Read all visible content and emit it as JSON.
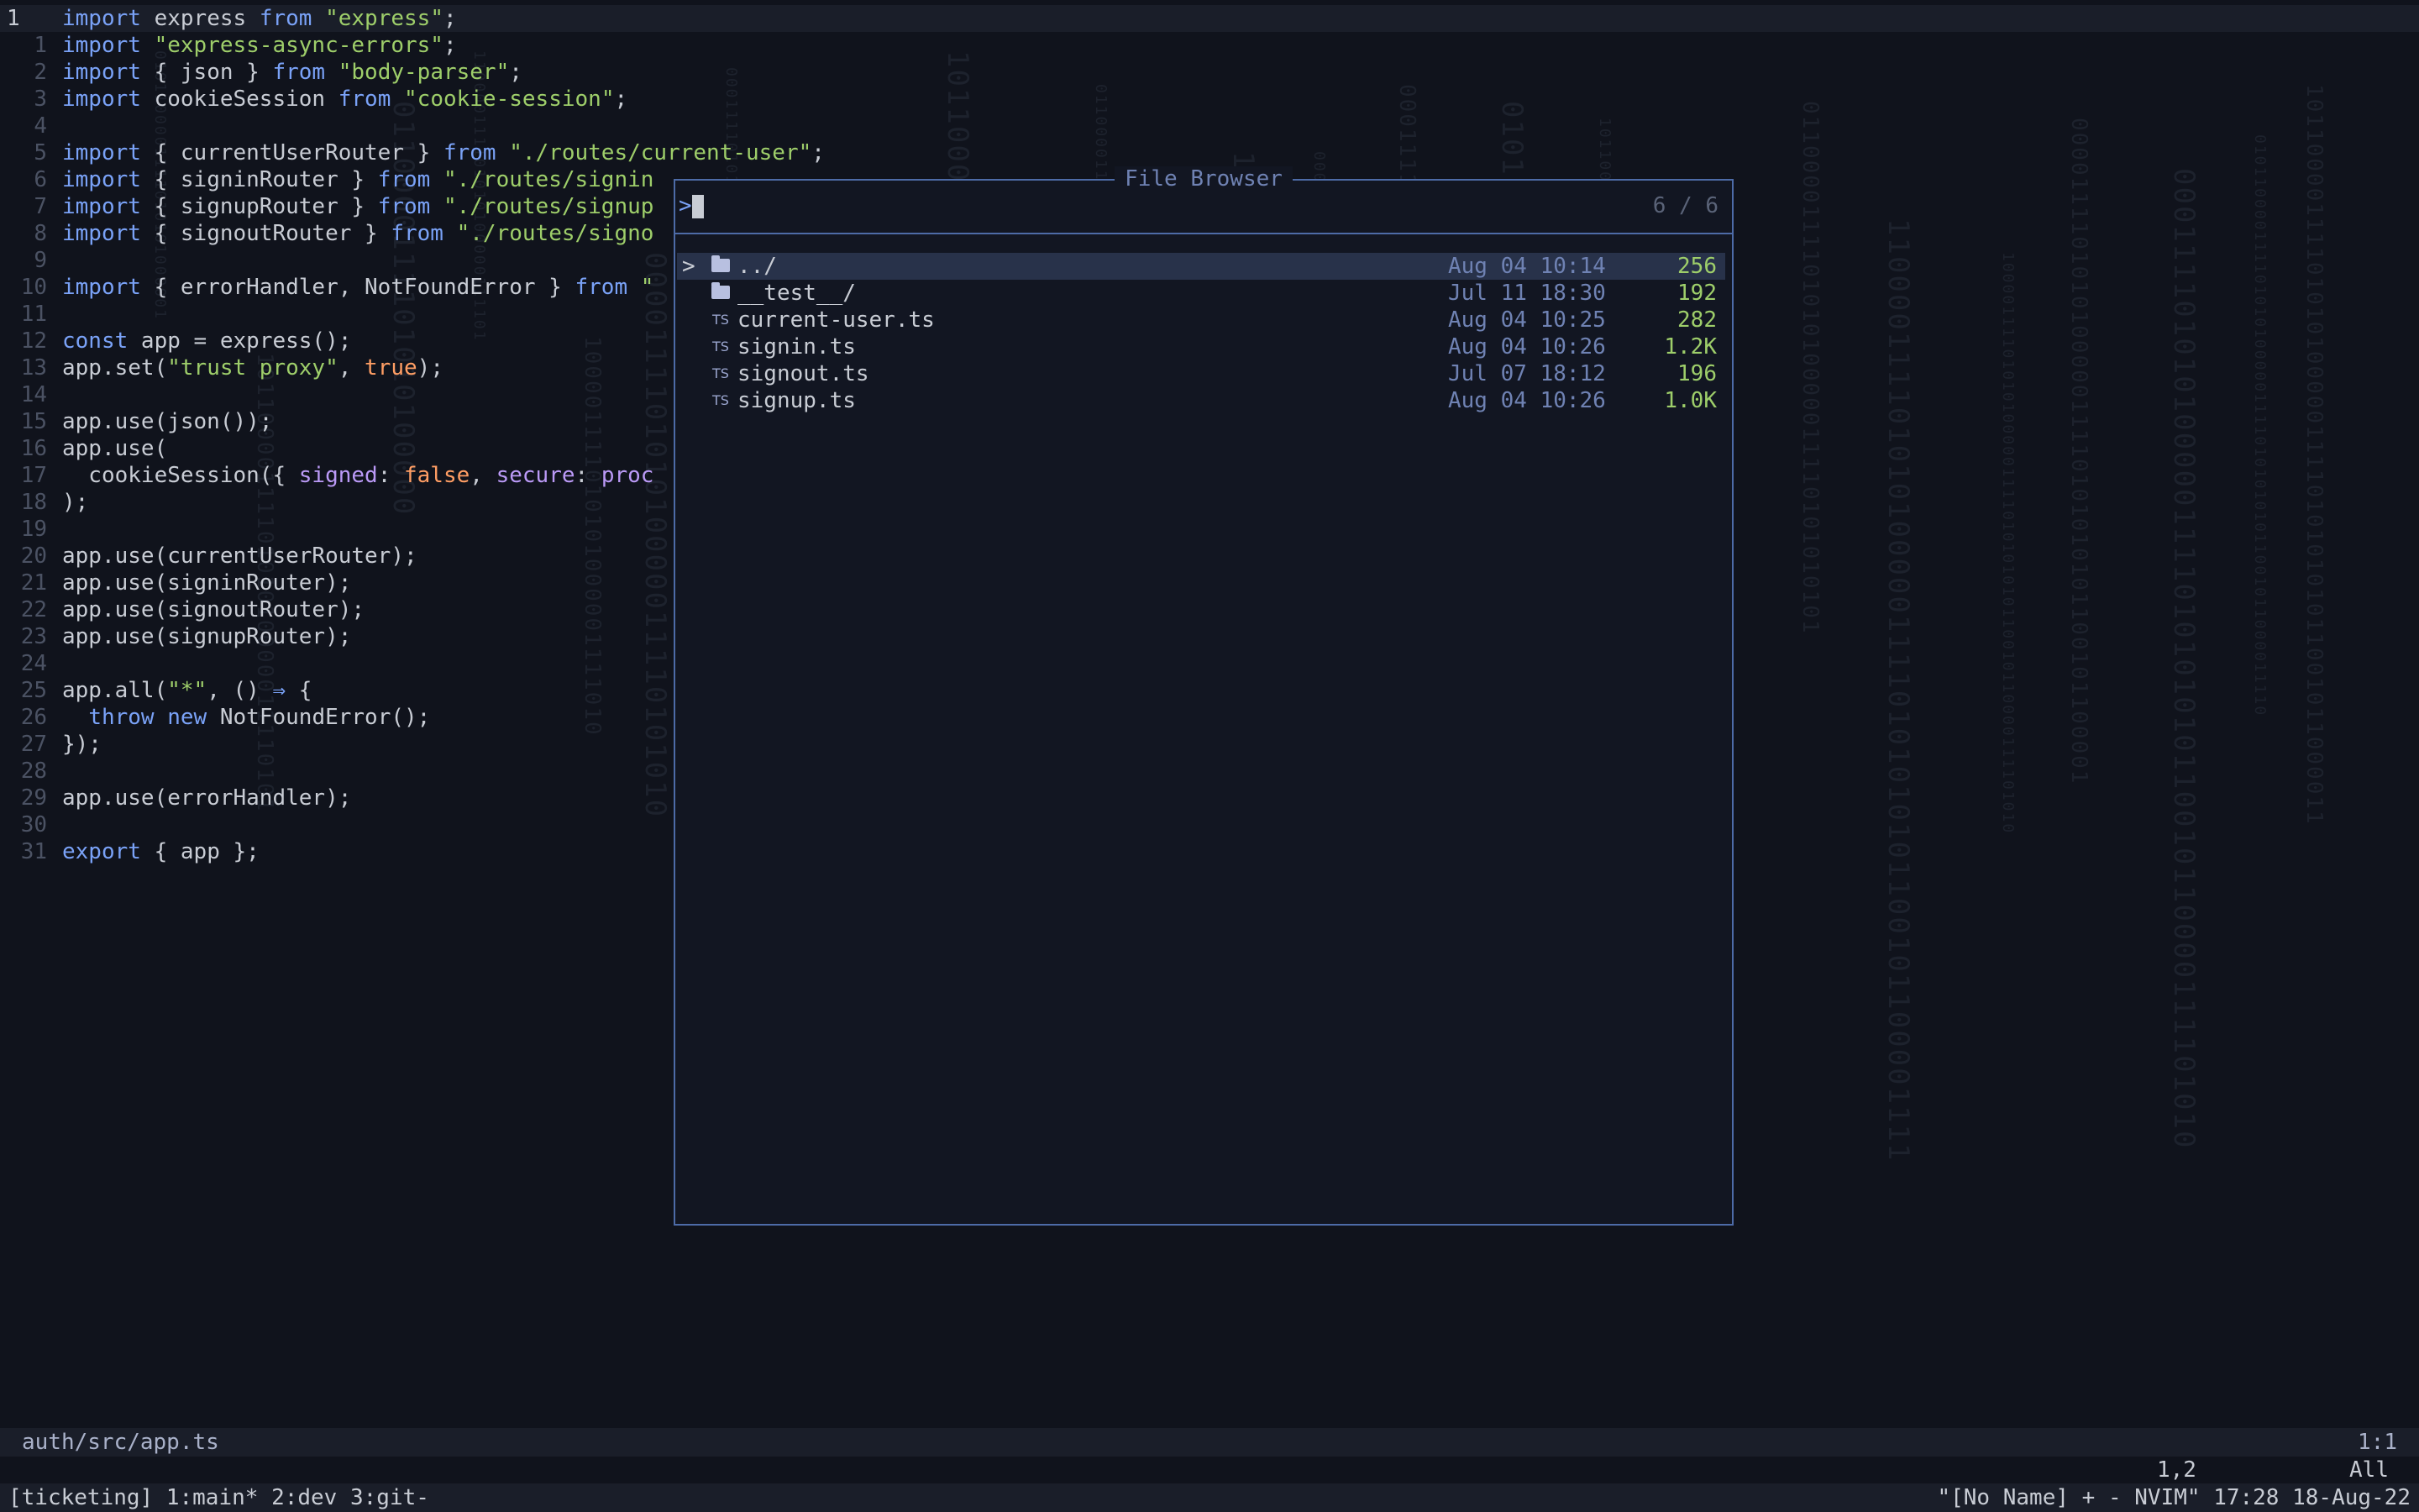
{
  "editor": {
    "lines": [
      {
        "n": "1",
        "t": [
          [
            "kw",
            "import"
          ],
          [
            "plain",
            " express "
          ],
          [
            "kw",
            "from"
          ],
          [
            "plain",
            " "
          ],
          [
            "str",
            "\"express\""
          ],
          [
            "plain",
            ";"
          ]
        ]
      },
      {
        "n": "1",
        "t": [
          [
            "kw",
            "import"
          ],
          [
            "plain",
            " "
          ],
          [
            "str",
            "\"express-async-errors\""
          ],
          [
            "plain",
            ";"
          ]
        ]
      },
      {
        "n": "2",
        "t": [
          [
            "kw",
            "import"
          ],
          [
            "plain",
            " { json } "
          ],
          [
            "kw",
            "from"
          ],
          [
            "plain",
            " "
          ],
          [
            "str",
            "\"body-parser\""
          ],
          [
            "plain",
            ";"
          ]
        ]
      },
      {
        "n": "3",
        "t": [
          [
            "kw",
            "import"
          ],
          [
            "plain",
            " cookieSession "
          ],
          [
            "kw",
            "from"
          ],
          [
            "plain",
            " "
          ],
          [
            "str",
            "\"cookie-session\""
          ],
          [
            "plain",
            ";"
          ]
        ]
      },
      {
        "n": "4",
        "t": []
      },
      {
        "n": "5",
        "t": [
          [
            "kw",
            "import"
          ],
          [
            "plain",
            " { currentUserRouter } "
          ],
          [
            "kw",
            "from"
          ],
          [
            "plain",
            " "
          ],
          [
            "str",
            "\"./routes/current-user\""
          ],
          [
            "plain",
            ";"
          ]
        ]
      },
      {
        "n": "6",
        "t": [
          [
            "kw",
            "import"
          ],
          [
            "plain",
            " { signinRouter } "
          ],
          [
            "kw",
            "from"
          ],
          [
            "plain",
            " "
          ],
          [
            "str",
            "\"./routes/signin"
          ]
        ]
      },
      {
        "n": "7",
        "t": [
          [
            "kw",
            "import"
          ],
          [
            "plain",
            " { signupRouter } "
          ],
          [
            "kw",
            "from"
          ],
          [
            "plain",
            " "
          ],
          [
            "str",
            "\"./routes/signup"
          ]
        ]
      },
      {
        "n": "8",
        "t": [
          [
            "kw",
            "import"
          ],
          [
            "plain",
            " { signoutRouter } "
          ],
          [
            "kw",
            "from"
          ],
          [
            "plain",
            " "
          ],
          [
            "str",
            "\"./routes/signo"
          ]
        ]
      },
      {
        "n": "9",
        "t": []
      },
      {
        "n": "10",
        "t": [
          [
            "kw",
            "import"
          ],
          [
            "plain",
            " { errorHandler, NotFoundError } "
          ],
          [
            "kw",
            "from"
          ],
          [
            "plain",
            " "
          ],
          [
            "str",
            "\""
          ]
        ]
      },
      {
        "n": "11",
        "t": []
      },
      {
        "n": "12",
        "t": [
          [
            "kw",
            "const"
          ],
          [
            "plain",
            " app = express();"
          ]
        ]
      },
      {
        "n": "13",
        "t": [
          [
            "plain",
            "app.set("
          ],
          [
            "str",
            "\"trust proxy\""
          ],
          [
            "plain",
            ", "
          ],
          [
            "bool",
            "true"
          ],
          [
            "plain",
            ");"
          ]
        ]
      },
      {
        "n": "14",
        "t": []
      },
      {
        "n": "15",
        "t": [
          [
            "plain",
            "app.use(json());"
          ]
        ]
      },
      {
        "n": "16",
        "t": [
          [
            "plain",
            "app.use("
          ]
        ]
      },
      {
        "n": "17",
        "t": [
          [
            "plain",
            "  cookieSession({ "
          ],
          [
            "prop",
            "signed"
          ],
          [
            "plain",
            ": "
          ],
          [
            "bool",
            "false"
          ],
          [
            "plain",
            ", "
          ],
          [
            "prop",
            "secure"
          ],
          [
            "plain",
            ": "
          ],
          [
            "prop",
            "proc"
          ]
        ]
      },
      {
        "n": "18",
        "t": [
          [
            "plain",
            ");"
          ]
        ]
      },
      {
        "n": "19",
        "t": []
      },
      {
        "n": "20",
        "t": [
          [
            "plain",
            "app.use(currentUserRouter);"
          ]
        ]
      },
      {
        "n": "21",
        "t": [
          [
            "plain",
            "app.use(signinRouter);"
          ]
        ]
      },
      {
        "n": "22",
        "t": [
          [
            "plain",
            "app.use(signoutRouter);"
          ]
        ]
      },
      {
        "n": "23",
        "t": [
          [
            "plain",
            "app.use(signupRouter);"
          ]
        ]
      },
      {
        "n": "24",
        "t": []
      },
      {
        "n": "25",
        "t": [
          [
            "plain",
            "app.all("
          ],
          [
            "str",
            "\"*\""
          ],
          [
            "plain",
            ", () "
          ],
          [
            "kw",
            "⇒"
          ],
          [
            "plain",
            " {"
          ]
        ]
      },
      {
        "n": "26",
        "t": [
          [
            "plain",
            "  "
          ],
          [
            "kw",
            "throw"
          ],
          [
            "plain",
            " "
          ],
          [
            "kw",
            "new"
          ],
          [
            "plain",
            " NotFoundError();"
          ]
        ]
      },
      {
        "n": "27",
        "t": [
          [
            "plain",
            "});"
          ]
        ]
      },
      {
        "n": "28",
        "t": []
      },
      {
        "n": "29",
        "t": [
          [
            "plain",
            "app.use(errorHandler);"
          ]
        ]
      },
      {
        "n": "30",
        "t": []
      },
      {
        "n": "31",
        "t": [
          [
            "kw",
            "export"
          ],
          [
            "plain",
            " { app };"
          ]
        ]
      }
    ]
  },
  "file_browser": {
    "title": "File Browser",
    "prompt": ">",
    "count": "6 / 6",
    "selected_marker": ">",
    "entries": [
      {
        "icon": "folder-icon",
        "name": "../",
        "date": "Aug 04 10:14",
        "size": "256",
        "selected": true
      },
      {
        "icon": "folder-icon",
        "name": "__test__/",
        "date": "Jul 11 18:30",
        "size": "192",
        "selected": false
      },
      {
        "icon": "typescript-file-icon",
        "name": "current-user.ts",
        "date": "Aug 04 10:25",
        "size": "282",
        "selected": false
      },
      {
        "icon": "typescript-file-icon",
        "name": "signin.ts",
        "date": "Aug 04 10:26",
        "size": "1.2K",
        "selected": false
      },
      {
        "icon": "typescript-file-icon",
        "name": "signout.ts",
        "date": "Jul 07 18:12",
        "size": "196",
        "selected": false
      },
      {
        "icon": "typescript-file-icon",
        "name": "signup.ts",
        "date": "Aug 04 10:26",
        "size": "1.0K",
        "selected": false
      }
    ],
    "ts_icon_text": "TS"
  },
  "statusline": {
    "file": "auth/src/app.ts",
    "position": "1:1"
  },
  "cmdline": {
    "cursor_pos": "1,2",
    "scroll": "All"
  },
  "tmux": {
    "left": "[ticketing] 1:main* 2:dev  3:git-",
    "right": "\"[No Name] + - NVIM\" 17:28 18-Aug-22"
  },
  "colors": {
    "background": "#10131c",
    "keyword": "#7aa2f7",
    "string": "#9ece6a",
    "boolean": "#ff9e64",
    "property": "#bb9af7",
    "border": "#4d6ba7",
    "selection": "#28324a"
  }
}
